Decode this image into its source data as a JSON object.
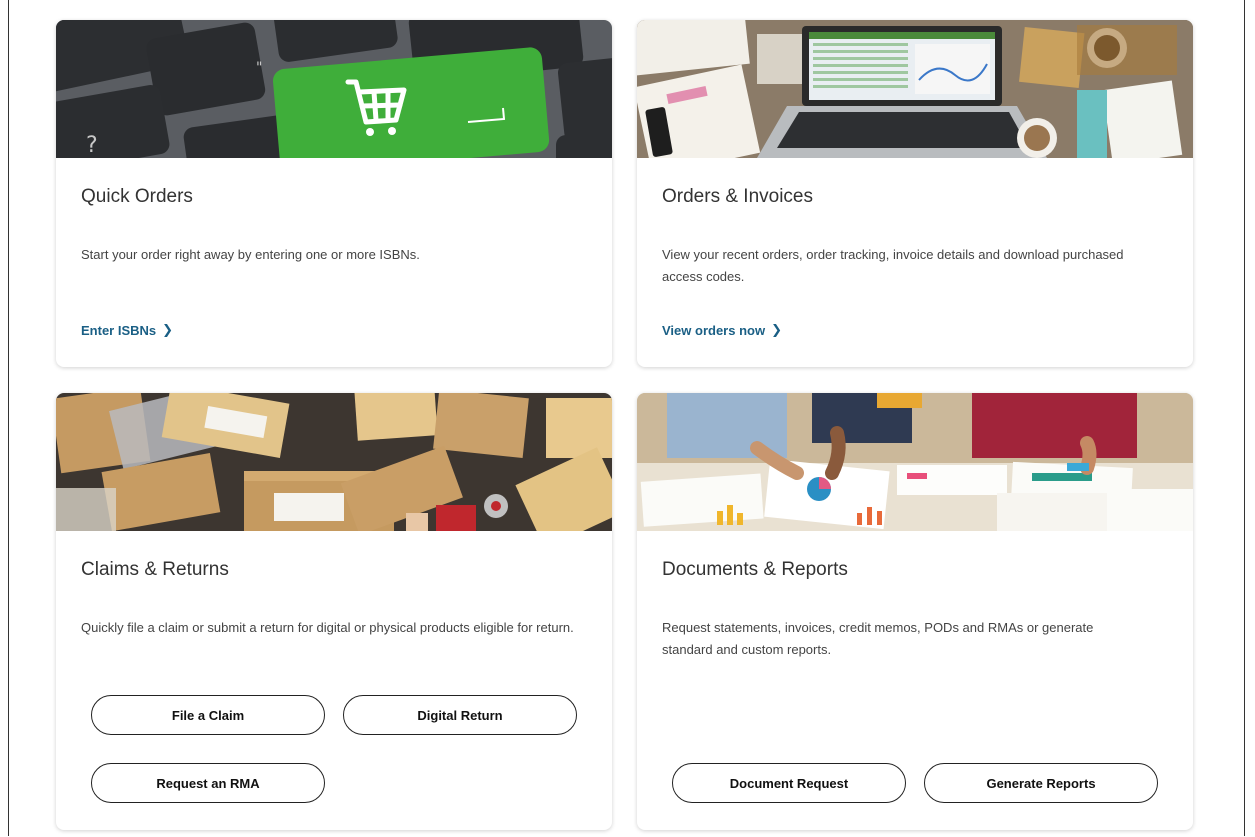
{
  "cards": {
    "quick_orders": {
      "title": "Quick Orders",
      "description": "Start your order right away by entering one or more ISBNs.",
      "link": "Enter ISBNs"
    },
    "orders_invoices": {
      "title": "Orders & Invoices",
      "description": "View your recent orders, order tracking, invoice details and download purchased access codes.",
      "link": "View orders now"
    },
    "claims_returns": {
      "title": "Claims & Returns",
      "description": "Quickly file a claim or submit a return for digital or physical products eligible for return.",
      "buttons": [
        "File a Claim",
        "Digital Return",
        "Request an RMA"
      ]
    },
    "documents_reports": {
      "title": "Documents & Reports",
      "description": "Request statements, invoices, credit memos, PODs and RMAs or generate standard and custom reports.",
      "buttons": [
        "Document Request",
        "Generate Reports"
      ]
    }
  },
  "icons": {
    "link_chevron": "chevron-right-icon"
  },
  "colors": {
    "link": "#1a5f85",
    "cart_key_green": "#3fae3a"
  }
}
